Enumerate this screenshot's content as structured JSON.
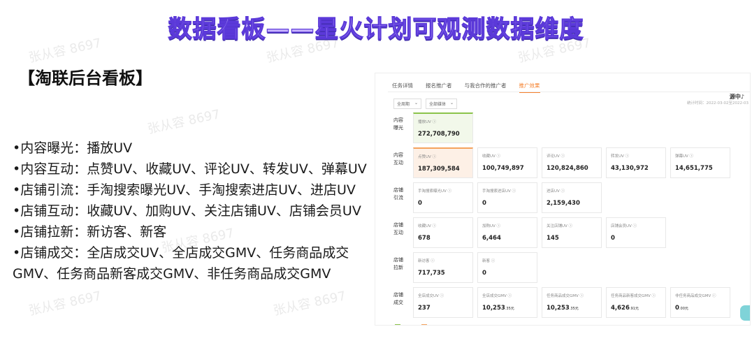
{
  "slide": {
    "title": "数据看板——星火计划可观测数据维度",
    "section_heading": "【淘联后台看板】",
    "bullets": [
      "•内容曝光：播放UV",
      "•内容互动：点赞UV、收藏UV、评论UV、转发UV、弹幕UV",
      "•店铺引流：手淘搜索曝光UV、手淘搜索进店UV、进店UV",
      "•店铺互动：收藏UV、加购UV、关注店铺UV、店铺会员UV",
      "•店铺拉新：新访客、新客",
      "•店铺成交：全店成交UV、全店成交GMV、任务商品成交\nGMV、任务商品新客成交GMV、非任务商品成交GMV"
    ],
    "watermark": "张从容 8697"
  },
  "dashboard": {
    "tabs": [
      "任务详情",
      "报名推广者",
      "与我合作的推广者",
      "推广效果"
    ],
    "active_tab": 3,
    "filters": [
      "全周期",
      "全部媒体"
    ],
    "corner_logo": "源中♪",
    "date_range": "统计时间：2022-03-02至2022-03",
    "rows": [
      {
        "label": "内容\n曝光",
        "cards": [
          {
            "label": "播放UV ⓘ",
            "value": "272,708,790",
            "style": "green"
          }
        ]
      },
      {
        "label": "内容\n互动",
        "cards": [
          {
            "label": "点赞UV ⓘ",
            "value": "187,309,584",
            "style": "orange"
          },
          {
            "label": "收藏UV ⓘ",
            "value": "100,749,897"
          },
          {
            "label": "评论UV ⓘ",
            "value": "120,824,860"
          },
          {
            "label": "转发UV ⓘ",
            "value": "43,130,972"
          },
          {
            "label": "弹幕UV ⓘ",
            "value": "14,651,775"
          }
        ]
      },
      {
        "label": "店铺\n引流",
        "cards": [
          {
            "label": "手淘搜索曝光UV ⓘ",
            "value": "0"
          },
          {
            "label": "手淘搜索进店UV ⓘ",
            "value": "0"
          },
          {
            "label": "进店UV ⓘ",
            "value": "2,159,430"
          }
        ]
      },
      {
        "label": "店铺\n互动",
        "cards": [
          {
            "label": "收藏UV ⓘ",
            "value": "678"
          },
          {
            "label": "加购UV ⓘ",
            "value": "6,464"
          },
          {
            "label": "关注店铺UV ⓘ",
            "value": "145"
          },
          {
            "label": "店铺会员UV ⓘ",
            "value": "0"
          }
        ]
      },
      {
        "label": "店铺\n拉新",
        "cards": [
          {
            "label": "新访客 ⓘ",
            "value": "717,735"
          },
          {
            "label": "新客 ⓘ",
            "value": "0"
          }
        ]
      },
      {
        "label": "店铺\n成交",
        "cards": [
          {
            "label": "全店成交UV ⓘ",
            "value": "237"
          },
          {
            "label": "全店成交GMV ⓘ",
            "value": "10,253",
            "unit": ".35元"
          },
          {
            "label": "任务商品成交GMV ⓘ",
            "value": "10,253",
            "unit": ".35元"
          },
          {
            "label": "任务商品新客成交GMV ⓘ",
            "value": "4,626",
            "unit": ".91元"
          },
          {
            "label": "非任务商品成交GMV ⓘ",
            "value": "0",
            "unit": ".00元"
          }
        ]
      }
    ],
    "colors": {
      "accent": "#f5812d",
      "green": "#8bc34a",
      "orange": "#f5a25d"
    }
  }
}
